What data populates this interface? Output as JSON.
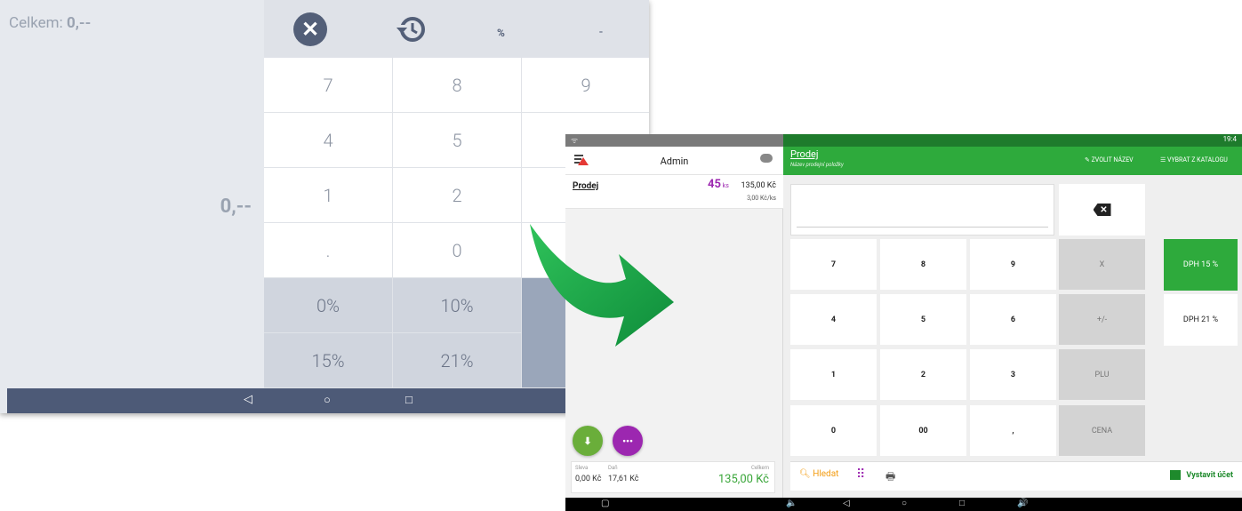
{
  "old_screen": {
    "total_label": "Celkem:",
    "total_value": "0,--",
    "display_value": "0,--",
    "top_pct": "%",
    "top_dash": "-",
    "keys": [
      [
        "7",
        "8",
        "9"
      ],
      [
        "4",
        "5",
        ""
      ],
      [
        "1",
        "2",
        ""
      ],
      [
        ".",
        "0",
        ""
      ]
    ],
    "vat_keys": [
      [
        "0%",
        "10%"
      ],
      [
        "15%",
        "21%"
      ]
    ],
    "nav": [
      "◁",
      "○",
      "□"
    ]
  },
  "new_screen": {
    "status_time": "19:4",
    "status_left": "ᯤ",
    "left": {
      "user": "Admin",
      "item_name": "Prodej",
      "item_qty": "45",
      "item_qty_unit": "ks",
      "item_price": "135,00 Kč",
      "item_unit_price": "3,00 Kč/ks",
      "fab_more": "•••",
      "discount_label": "Sleva",
      "discount_value": "0,00 Kč",
      "tax_label": "Daň",
      "tax_value": "17,61 Kč",
      "total_label": "Celkem",
      "total_value": "135,00 Kč"
    },
    "header": {
      "title": "Prodej",
      "subtitle": "Název prodejní položky",
      "rename_button": "ZVOLIT NÁZEV",
      "catalog_button": "VYBRAT Z KATALOGU"
    },
    "keypad": [
      [
        "7",
        "8",
        "9",
        "X"
      ],
      [
        "4",
        "5",
        "6",
        "+/-"
      ],
      [
        "1",
        "2",
        "3",
        "PLU"
      ],
      [
        "0",
        "00",
        ",",
        "CENA"
      ]
    ],
    "vat": [
      "DPH 15 %",
      "DPH 21 %"
    ],
    "bottom": {
      "search": "Hledat",
      "issue_bill": "Vystavit účet"
    },
    "nav": [
      "▢",
      "🔈",
      "◁",
      "○",
      "□",
      "🔊"
    ]
  }
}
